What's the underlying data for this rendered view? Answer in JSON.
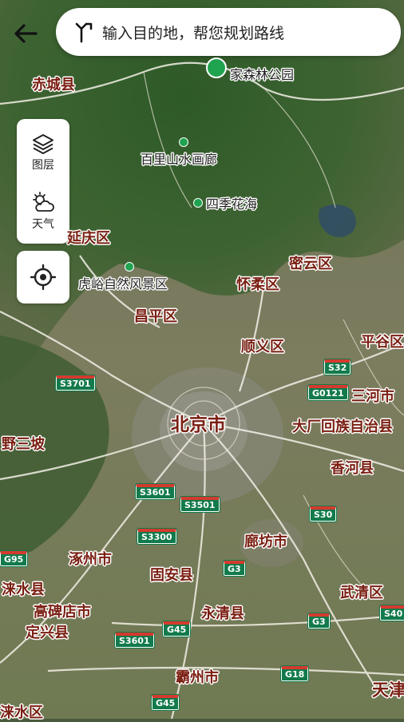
{
  "search": {
    "placeholder": "输入目的地，帮您规划路线"
  },
  "controls": {
    "layers_label": "图层",
    "weather_label": "天气"
  },
  "map": {
    "places": [
      {
        "name": "赤城县",
        "size": "mid"
      },
      {
        "name": "延庆区",
        "size": "mid"
      },
      {
        "name": "怀柔区",
        "size": "mid"
      },
      {
        "name": "密云区",
        "size": "mid"
      },
      {
        "name": "昌平区",
        "size": "mid"
      },
      {
        "name": "顺义区",
        "size": "mid"
      },
      {
        "name": "平谷区",
        "size": "mid"
      },
      {
        "name": "三河市",
        "size": "mid"
      },
      {
        "name": "北京市",
        "size": "capital"
      },
      {
        "name": "大厂回族自治县",
        "size": "mid"
      },
      {
        "name": "野三坡",
        "size": "mid"
      },
      {
        "name": "香河县",
        "size": "mid"
      },
      {
        "name": "廊坊市",
        "size": "mid"
      },
      {
        "name": "涿州市",
        "size": "mid"
      },
      {
        "name": "固安县",
        "size": "mid"
      },
      {
        "name": "涞水县",
        "size": "mid"
      },
      {
        "name": "武清区",
        "size": "mid"
      },
      {
        "name": "高碑店市",
        "size": "mid"
      },
      {
        "name": "永清县",
        "size": "mid"
      },
      {
        "name": "定兴县",
        "size": "mid"
      },
      {
        "name": "霸州市",
        "size": "mid"
      },
      {
        "name": "天津",
        "size": "big"
      },
      {
        "name": "涞水区",
        "size": "mid"
      }
    ],
    "pois": [
      {
        "name": "百里山水画廊"
      },
      {
        "name": "四季花海"
      },
      {
        "name": "虎峪自然风景区"
      }
    ],
    "pois_partial": [
      {
        "name": "家森林公园"
      }
    ],
    "road_shields": [
      "S3701",
      "G0121",
      "S32",
      "S3601",
      "S3501",
      "S3300",
      "S30",
      "G3",
      "G95",
      "G3",
      "S40",
      "G45",
      "S3601",
      "G18",
      "G45"
    ]
  },
  "colors": {
    "place_label": "#7a1f12",
    "poi_dot": "#1fa34f",
    "shield_bg": "#127a4b",
    "shield_top": "#d43a2e"
  }
}
